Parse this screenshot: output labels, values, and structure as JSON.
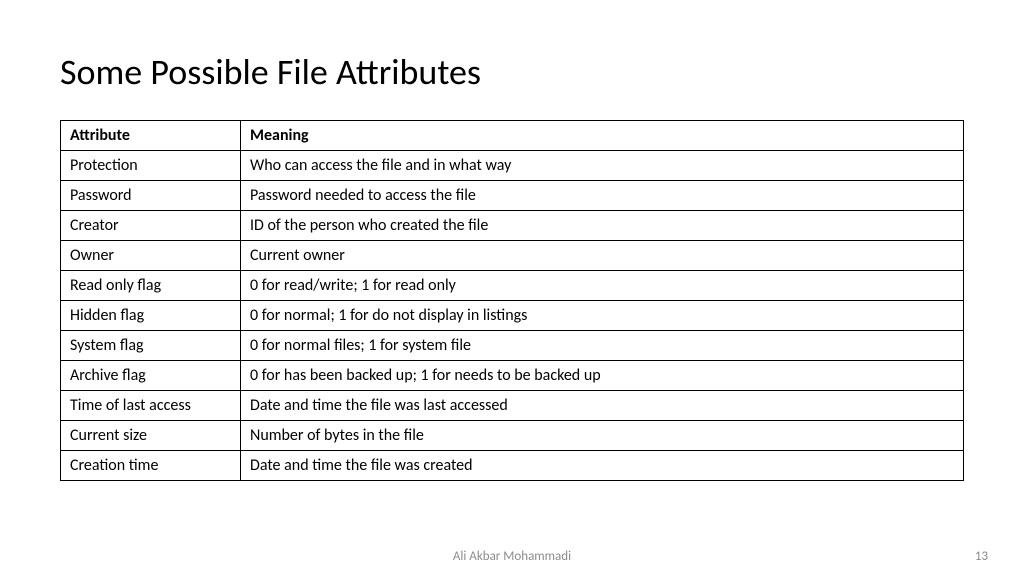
{
  "title": "Some Possible File Attributes",
  "table": {
    "headers": [
      "Attribute",
      "Meaning"
    ],
    "rows": [
      {
        "attribute": "Protection",
        "meaning": "Who can access the file and in what way"
      },
      {
        "attribute": "Password",
        "meaning": "Password needed to access the file"
      },
      {
        "attribute": "Creator",
        "meaning": "ID of the person who created the file"
      },
      {
        "attribute": "Owner",
        "meaning": "Current owner"
      },
      {
        "attribute": "Read only flag",
        "meaning": "0 for read/write; 1 for read only"
      },
      {
        "attribute": "Hidden flag",
        "meaning": "0 for normal; 1 for do not display in listings"
      },
      {
        "attribute": "System flag",
        "meaning": "0 for normal files; 1 for system file"
      },
      {
        "attribute": "Archive flag",
        "meaning": "0 for has been backed up; 1 for needs to be backed up"
      },
      {
        "attribute": "Time of last access",
        "meaning": "Date and time the file was last accessed"
      },
      {
        "attribute": "Current size",
        "meaning": "Number of bytes in the file"
      },
      {
        "attribute": "Creation time",
        "meaning": "Date and time the file was created"
      }
    ]
  },
  "footer": {
    "author": "Ali Akbar Mohammadi",
    "page_number": "13"
  }
}
